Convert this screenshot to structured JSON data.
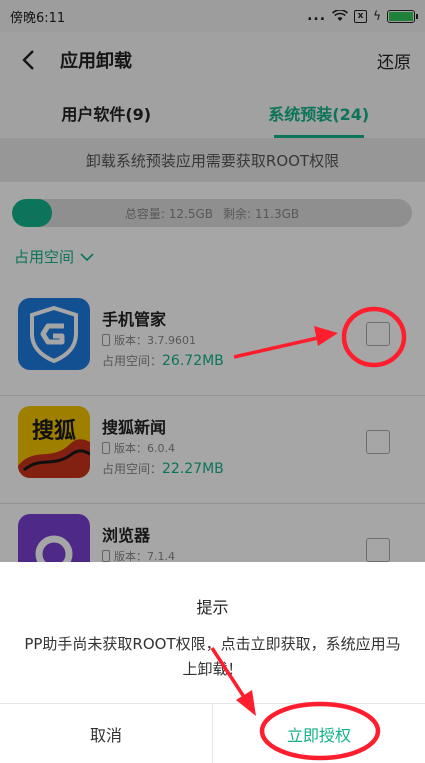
{
  "status_bar": {
    "time": "傍晚6:11",
    "signal_dots": "...",
    "sim_mark": "x",
    "charging": "ϟ",
    "battery_level": 1.0
  },
  "header": {
    "title": "应用卸载",
    "restore_label": "还原"
  },
  "tabs": [
    {
      "label": "用户软件(9)",
      "active": false
    },
    {
      "label": "系统预装(24)",
      "active": true
    }
  ],
  "notice": "卸载系统预装应用需要获取ROOT权限",
  "storage": {
    "total_label": "总容量: 12.5GB",
    "free_label": "剩余: 11.3GB",
    "used_fraction": 0.1
  },
  "sort": {
    "label": "占用空间"
  },
  "apps": [
    {
      "name": "手机管家",
      "version": "版本：3.7.9601",
      "space_label": "占用空间：",
      "size": "26.72MB",
      "checked": false
    },
    {
      "name": "搜狐新闻",
      "version": "版本：6.0.4",
      "space_label": "占用空间：",
      "size": "22.27MB",
      "checked": false
    },
    {
      "name": "浏览器",
      "version": "版本：7.1.4",
      "space_label": "",
      "size": "",
      "checked": false
    }
  ],
  "app_icon_text": {
    "sohu": "搜狐"
  },
  "dialog": {
    "title": "提示",
    "message": "PP助手尚未获取ROOT权限，点击立即获取，系统应用马上卸载！",
    "cancel_label": "取消",
    "authorize_label": "立即授权"
  },
  "colors": {
    "accent": "#13b28a",
    "annotation_red": "#ff1e2d"
  }
}
